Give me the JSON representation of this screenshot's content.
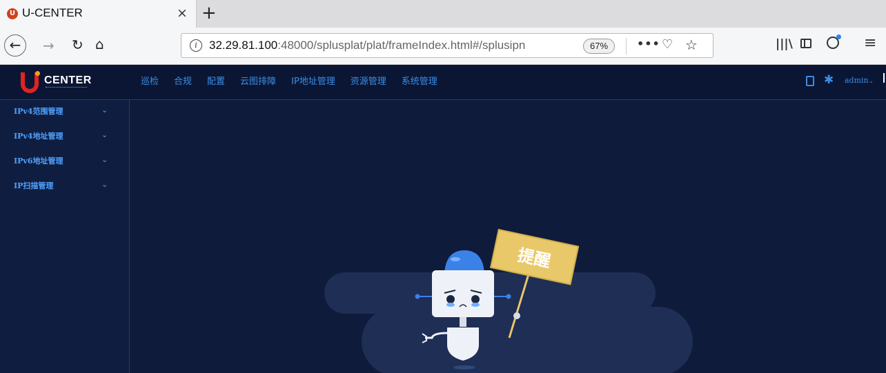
{
  "browser": {
    "tab_title": "U-CENTER",
    "tab_close": "×",
    "new_tab": "+",
    "url_host": "32.29.81.100",
    "url_rest": ":48000/splusplat/plat/frameIndex.html#/splusipn",
    "zoom": "67%",
    "icons": [
      "back-icon",
      "forward-icon",
      "reload-icon",
      "home-icon",
      "info-icon",
      "page-actions-icon",
      "pocket-icon",
      "bookmark-star-icon",
      "library-icon",
      "sidebar-icon",
      "account-icon",
      "menu-icon"
    ]
  },
  "app": {
    "logo_text": "CENTER",
    "brand_colors": {
      "logo_red": "#e02323",
      "accent_blue": "#3a8ee6",
      "background": "#0f1b3a"
    },
    "nav": [
      "巡检",
      "合规",
      "配置",
      "云图排障",
      "IP地址管理",
      "资源管理",
      "系统管理"
    ],
    "user": "admin"
  },
  "sidebar": {
    "items": [
      {
        "label": "IPv4范围管理"
      },
      {
        "label": "IPv4地址管理"
      },
      {
        "label": "IPv6地址管理"
      },
      {
        "label": "IP扫描管理"
      }
    ]
  },
  "main": {
    "sign_text": "提醒"
  }
}
